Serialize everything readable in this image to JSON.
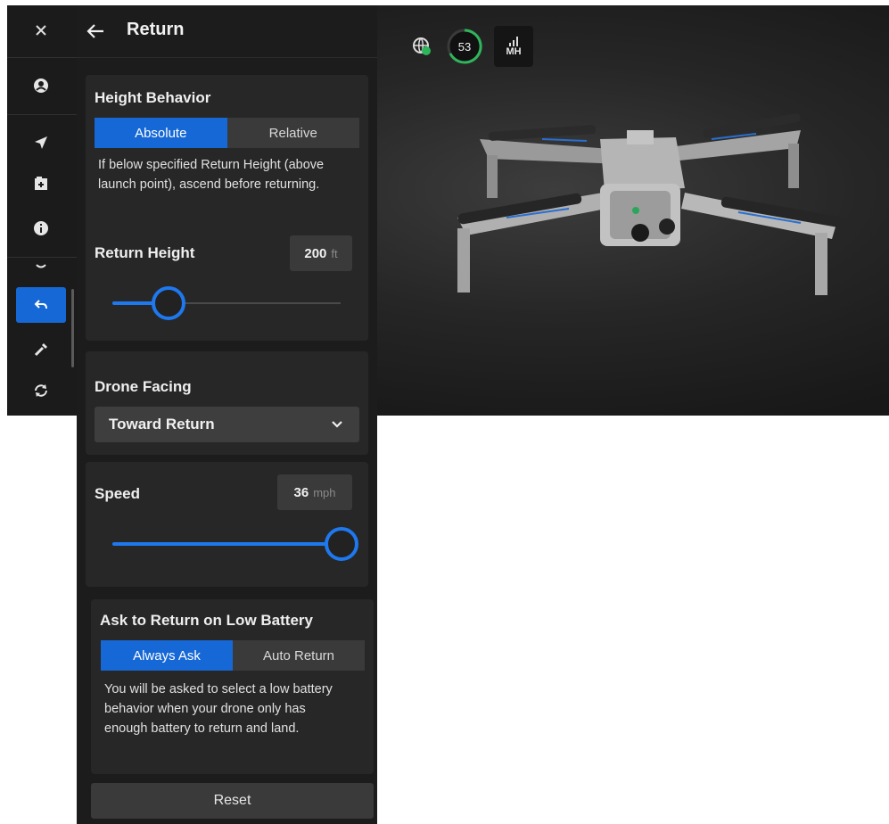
{
  "panel": {
    "title": "Return"
  },
  "height_behavior": {
    "title": "Height Behavior",
    "options": [
      "Absolute",
      "Relative"
    ],
    "selected": "Absolute",
    "description": "If below specified Return Height (above launch point), ascend before returning."
  },
  "return_height": {
    "label": "Return Height",
    "value": "200",
    "unit": "ft",
    "slider_fraction": 0.2
  },
  "drone_facing": {
    "label": "Drone Facing",
    "selected": "Toward Return"
  },
  "speed": {
    "label": "Speed",
    "value": "36",
    "unit": "mph",
    "slider_fraction": 1.0
  },
  "low_battery": {
    "title": "Ask to Return on Low Battery",
    "options": [
      "Always Ask",
      "Auto Return"
    ],
    "selected": "Always Ask",
    "description": "You will be asked to select a low battery behavior when your drone only has enough battery to return and land."
  },
  "reset_label": "Reset",
  "status": {
    "battery_value": "53",
    "signal_label": "MH"
  },
  "rail": {
    "icons": [
      "close-icon",
      "person-icon",
      "navigate-icon",
      "file-icon",
      "info-icon",
      "chevron-icon",
      "return-icon",
      "flashlight-icon",
      "sync-icon"
    ],
    "active": "return-icon"
  },
  "colors": {
    "accent": "#1668d6",
    "slider": "#1e78ee",
    "panel_bg": "#1c1c1c",
    "card_bg": "#272727"
  }
}
